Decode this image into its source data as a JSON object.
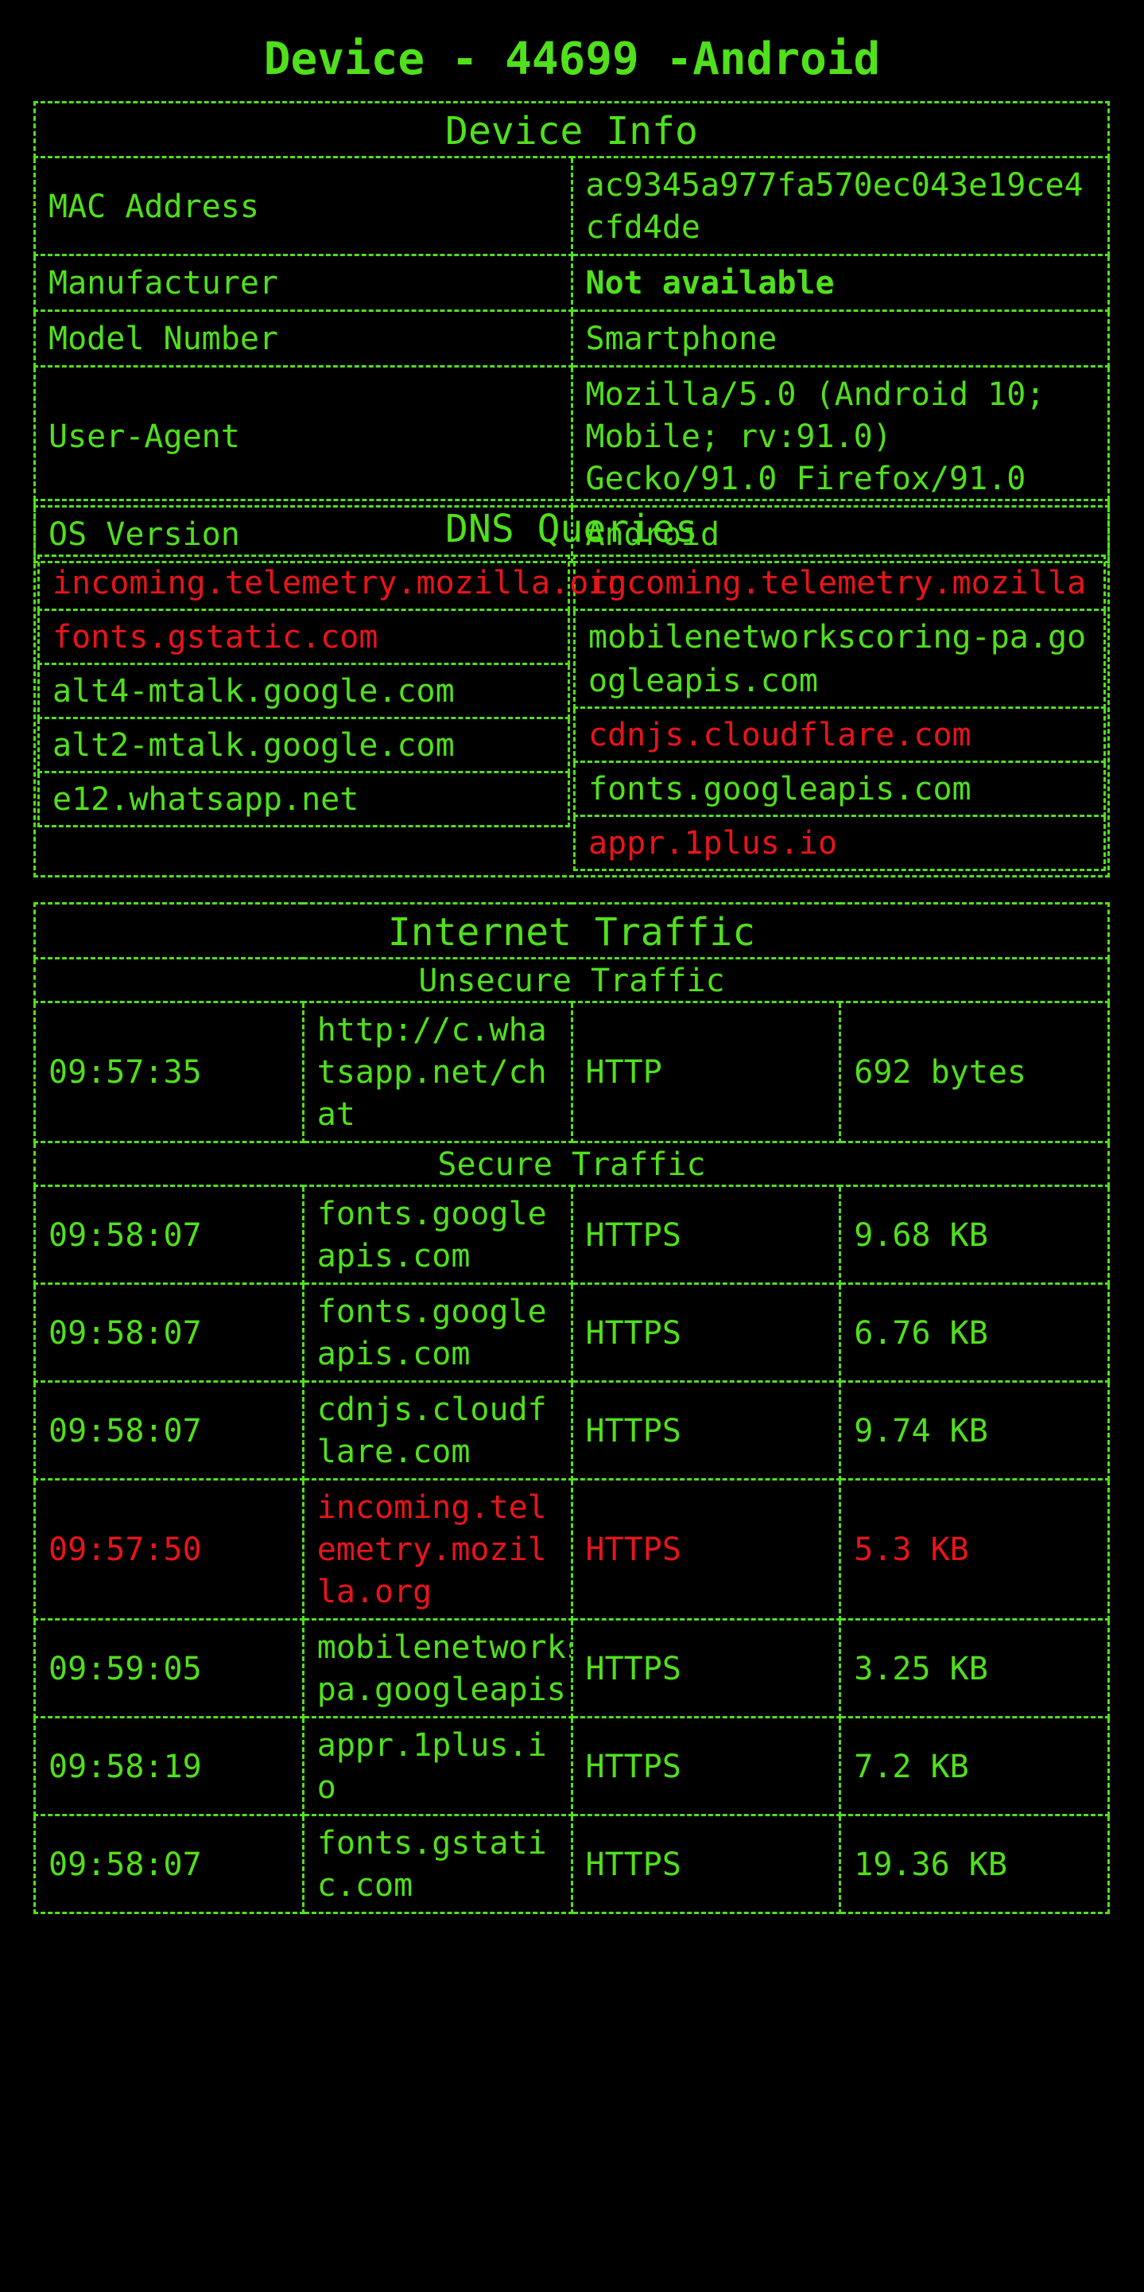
{
  "app": {
    "title": "Device - 44699 -Android"
  },
  "colors": {
    "background": "#000000",
    "accent": "#50e01c",
    "alert": "#e8141b"
  },
  "device_info": {
    "heading": "Device Info",
    "rows": [
      {
        "label": "MAC Address",
        "value": "ac9345a977fa570ec043e19ce4cfd4de",
        "bold": false
      },
      {
        "label": "Manufacturer",
        "value": "Not available",
        "bold": true
      },
      {
        "label": "Model Number",
        "value": "Smartphone",
        "bold": false
      },
      {
        "label": "User-Agent",
        "value": "Mozilla/5.0 (Android 10; Mobile; rv:91.0) Gecko/91.0 Firefox/91.0",
        "bold": false
      },
      {
        "label": "OS Version",
        "value": "Android",
        "bold": false
      }
    ]
  },
  "dns_queries": {
    "heading": "DNS Queries",
    "left": [
      {
        "domain": "incoming.telemetry.mozilla.org",
        "flagged": true
      },
      {
        "domain": "fonts.gstatic.com",
        "flagged": true
      },
      {
        "domain": "alt4-mtalk.google.com",
        "flagged": false
      },
      {
        "domain": "alt2-mtalk.google.com",
        "flagged": false
      },
      {
        "domain": "e12.whatsapp.net",
        "flagged": false
      }
    ],
    "right": [
      {
        "domain": "incoming.telemetry.mozilla",
        "flagged": true
      },
      {
        "domain": "mobilenetworkscoring-pa.googleapis.com",
        "flagged": false
      },
      {
        "domain": "cdnjs.cloudflare.com",
        "flagged": true
      },
      {
        "domain": "fonts.googleapis.com",
        "flagged": false
      },
      {
        "domain": "appr.1plus.io",
        "flagged": true
      }
    ]
  },
  "internet_traffic": {
    "heading": "Internet Traffic",
    "unsecure_heading": "Unsecure Traffic",
    "unsecure": [
      {
        "time": "09:57:35",
        "host": "http://c.whatsapp.net/chat",
        "protocol": "HTTP",
        "size": "692 bytes",
        "flagged": false
      }
    ],
    "secure_heading": "Secure Traffic",
    "secure": [
      {
        "time": "09:58:07",
        "host": "fonts.googleapis.com",
        "protocol": "HTTPS",
        "size": "9.68 KB",
        "flagged": false
      },
      {
        "time": "09:58:07",
        "host": "fonts.googleapis.com",
        "protocol": "HTTPS",
        "size": "6.76 KB",
        "flagged": false
      },
      {
        "time": "09:58:07",
        "host": "cdnjs.cloudflare.com",
        "protocol": "HTTPS",
        "size": "9.74 KB",
        "flagged": false
      },
      {
        "time": "09:57:50",
        "host": "incoming.telemetry.mozilla.org",
        "protocol": "HTTPS",
        "size": "5.3 KB",
        "flagged": true
      },
      {
        "time": "09:59:05",
        "host": "mobilenetworkscoring-pa.googleapis.com",
        "protocol": "HTTPS",
        "size": "3.25 KB",
        "flagged": false
      },
      {
        "time": "09:58:19",
        "host": "appr.1plus.io",
        "protocol": "HTTPS",
        "size": "7.2 KB",
        "flagged": false
      },
      {
        "time": "09:58:07",
        "host": "fonts.gstatic.com",
        "protocol": "HTTPS",
        "size": "19.36 KB",
        "flagged": false
      }
    ]
  }
}
